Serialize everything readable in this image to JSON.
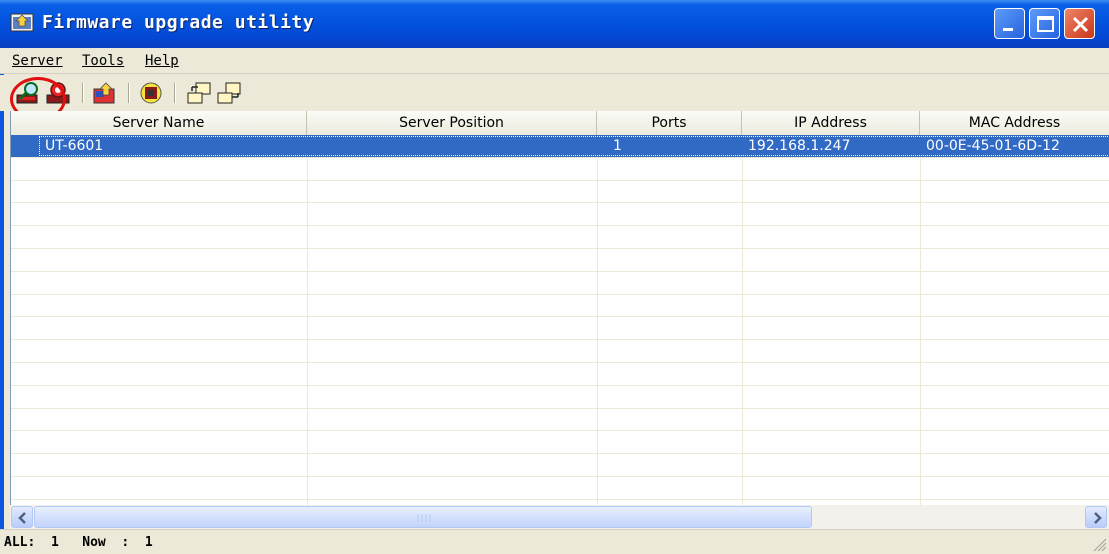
{
  "window": {
    "title": "Firmware upgrade utility"
  },
  "menu": {
    "items": [
      {
        "label": "Server"
      },
      {
        "label": "Tools"
      },
      {
        "label": "Help"
      }
    ]
  },
  "toolbar": {
    "buttons": [
      {
        "icon": "search-server-icon"
      },
      {
        "icon": "server-config-icon"
      },
      {
        "icon": "firmware-upgrade-icon"
      },
      {
        "icon": "chip-icon"
      },
      {
        "icon": "export-icon"
      },
      {
        "icon": "import-icon"
      }
    ],
    "highlight_color": "#e01010"
  },
  "table": {
    "columns": [
      "Server Name",
      "Server Position",
      "Ports",
      "IP Address",
      "MAC Address"
    ],
    "rows": [
      {
        "server_name": "UT-6601",
        "server_position": "",
        "ports": "1",
        "ip_address": "192.168.1.247",
        "mac_address": "00-0E-45-01-6D-12",
        "selected": true
      }
    ],
    "selection_color": "#316ac5"
  },
  "status": {
    "text": "ALL:  1   Now  :  1"
  }
}
